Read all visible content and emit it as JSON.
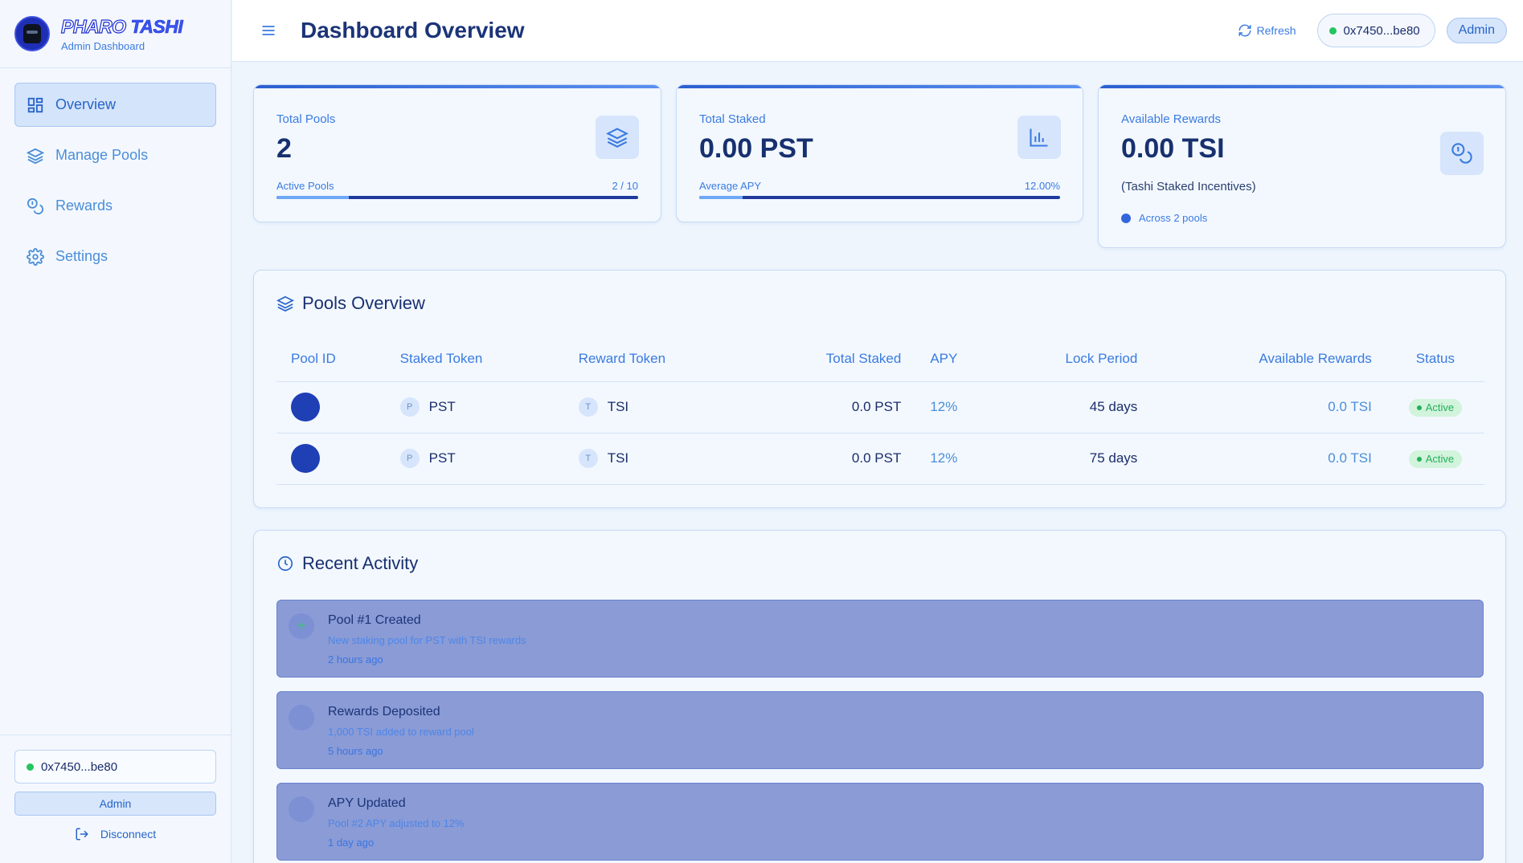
{
  "brand": {
    "name_part1": "PHARO",
    "name_part2": "TASHI",
    "subtitle": "Admin Dashboard"
  },
  "sidebar": {
    "items": [
      {
        "label": "Overview",
        "icon": "grid-icon",
        "active": true
      },
      {
        "label": "Manage Pools",
        "icon": "layers-icon",
        "active": false
      },
      {
        "label": "Rewards",
        "icon": "coins-icon",
        "active": false
      },
      {
        "label": "Settings",
        "icon": "gear-icon",
        "active": false
      }
    ],
    "wallet_address": "0x7450...be80",
    "role": "Admin",
    "disconnect_label": "Disconnect"
  },
  "header": {
    "title": "Dashboard Overview",
    "refresh_label": "Refresh",
    "wallet_address": "0x7450...be80",
    "role": "Admin"
  },
  "stats": {
    "total_pools": {
      "label": "Total Pools",
      "value": "2",
      "sub_label": "Active Pools",
      "sub_value": "2 / 10",
      "progress": 0.2
    },
    "total_staked": {
      "label": "Total Staked",
      "value": "0.00 PST",
      "sub_label": "Average APY",
      "sub_value": "12.00%",
      "progress": 0.12
    },
    "available_rewards": {
      "label": "Available Rewards",
      "value": "0.00 TSI",
      "note": "(Tashi Staked Incentives)",
      "pools_note": "Across 2 pools"
    }
  },
  "pools": {
    "title": "Pools Overview",
    "columns": [
      "Pool ID",
      "Staked Token",
      "Reward Token",
      "Total Staked",
      "APY",
      "Lock Period",
      "Available Rewards",
      "Status"
    ],
    "rows": [
      {
        "staked_badge": "P",
        "staked_token": "PST",
        "reward_badge": "T",
        "reward_token": "TSI",
        "total_staked": "0.0 PST",
        "apy": "12%",
        "lock_period": "45 days",
        "available_rewards": "0.0 TSI",
        "status": "Active"
      },
      {
        "staked_badge": "P",
        "staked_token": "PST",
        "reward_badge": "T",
        "reward_token": "TSI",
        "total_staked": "0.0 PST",
        "apy": "12%",
        "lock_period": "75 days",
        "available_rewards": "0.0 TSI",
        "status": "Active"
      }
    ]
  },
  "activity": {
    "title": "Recent Activity",
    "items": [
      {
        "title": "Pool #1 Created",
        "description": "New staking pool for PST with TSI rewards",
        "time": "2 hours ago",
        "icon": "plus-icon"
      },
      {
        "title": "Rewards Deposited",
        "description": "1,000 TSI added to reward pool",
        "time": "5 hours ago",
        "icon": "coins-icon"
      },
      {
        "title": "APY Updated",
        "description": "Pool #2 APY adjusted to 12%",
        "time": "1 day ago",
        "icon": "percent-icon"
      }
    ]
  },
  "colors": {
    "accent": "#3a7be0",
    "primary": "#1b3478",
    "active_green": "#23b05a"
  }
}
